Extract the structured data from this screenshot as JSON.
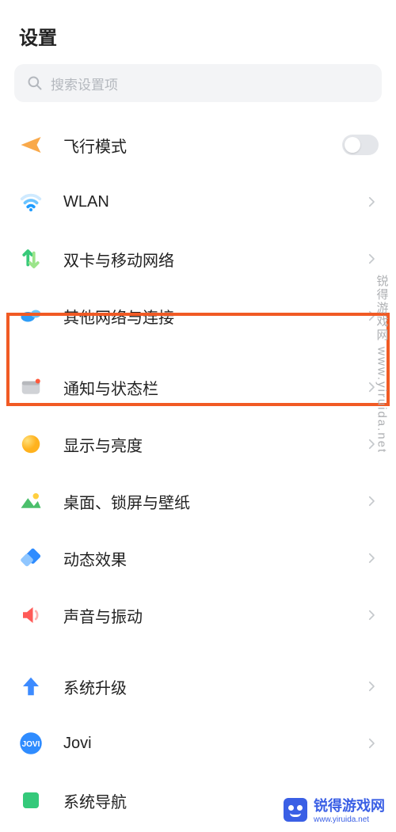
{
  "title": "设置",
  "search": {
    "placeholder": "搜索设置项"
  },
  "rows": {
    "airplane": {
      "label": "飞行模式"
    },
    "wlan": {
      "label": "WLAN"
    },
    "sim": {
      "label": "双卡与移动网络"
    },
    "othernet": {
      "label": "其他网络与连接"
    },
    "notif": {
      "label": "通知与状态栏"
    },
    "display": {
      "label": "显示与亮度"
    },
    "wallpaper": {
      "label": "桌面、锁屏与壁纸"
    },
    "motion": {
      "label": "动态效果"
    },
    "sound": {
      "label": "声音与振动"
    },
    "sysupdate": {
      "label": "系统升级"
    },
    "jovi": {
      "label": "Jovi"
    },
    "sysnav": {
      "label": "系统导航"
    }
  },
  "watermark": "锐得游戏网  www.yiruida.net",
  "banner": {
    "name": "锐得游戏网",
    "url": "www.yiruida.net"
  }
}
